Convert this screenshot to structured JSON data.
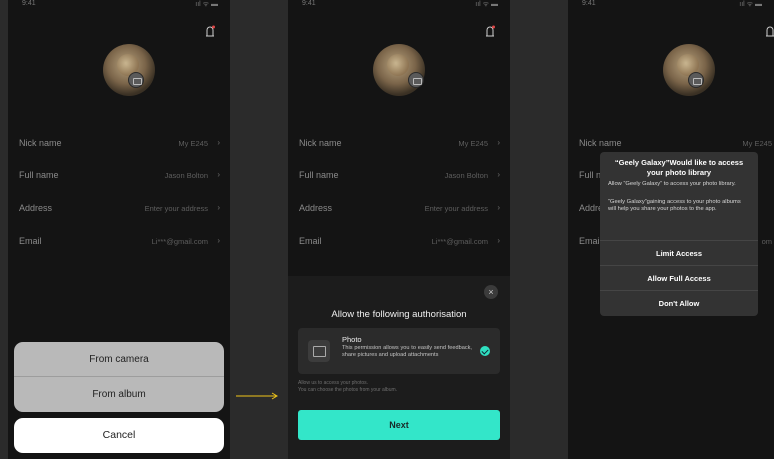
{
  "status_bar": {
    "time": "9:41",
    "signal": "ııl ᯤ ▬"
  },
  "profile": {
    "rows": [
      {
        "label": "Nick name",
        "value": "My E245"
      },
      {
        "label": "Full name",
        "value": "Jason Bolton"
      },
      {
        "label": "Address",
        "value": "Enter your address"
      },
      {
        "label": "Email",
        "value": "Li***@gmail.com"
      }
    ]
  },
  "action_sheet": {
    "from_camera": "From camera",
    "from_album": "From album",
    "cancel": "Cancel"
  },
  "authorisation": {
    "title": "Allow the following authorisation",
    "permission_title": "Photo",
    "permission_desc": "This permission allows you to easily send feedback, share pictures and upload attachments",
    "hint_line1": "Allow us to access your photos.",
    "hint_line2": "You can choose the photos from your album.",
    "next": "Next",
    "close_glyph": "×"
  },
  "ios_alert": {
    "title": "“Geely Galaxy”Would like to access your photo library",
    "message1": "Allow “Geely Galaxy” to access your photo library.",
    "message2": "“Geely Galaxy”gaining access to your photo albums will help you share your photos to the app.",
    "limit_access": "Limit Access",
    "allow_full_access": "Allow Full Access",
    "dont_allow": "Don't Allow",
    "visible_rows": [
      {
        "label": "Nick name",
        "value": "My E245"
      },
      {
        "label": "Full na",
        "value": ""
      },
      {
        "label": "Addre",
        "value": ""
      },
      {
        "label": "Email",
        "value": "om"
      }
    ]
  },
  "colors": {
    "accent": "#33e6c9",
    "panel_bg": "#141414",
    "arrow": "#f0c419"
  },
  "icons": [
    "bell-icon",
    "camera-icon",
    "chevron-right-icon",
    "close-icon",
    "image-icon",
    "check-circle-icon",
    "arrow-right-icon"
  ]
}
